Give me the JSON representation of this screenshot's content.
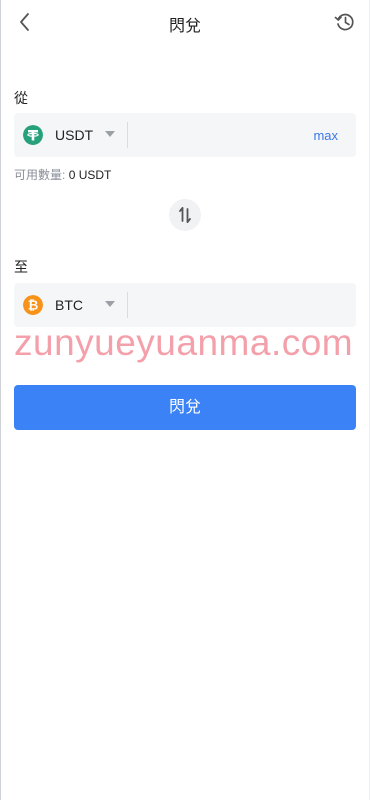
{
  "header": {
    "title": "閃兌"
  },
  "from": {
    "label": "從",
    "token": "USDT",
    "amount_placeholder": "",
    "max_label": "max",
    "available_label": "可用數量:",
    "available_value": "0 USDT",
    "icon_color": "#26a17b"
  },
  "to": {
    "label": "至",
    "token": "BTC",
    "amount_placeholder": "",
    "icon_color": "#f7931a"
  },
  "submit": {
    "label": "閃兌",
    "color": "#3b82f6"
  },
  "watermark": "zunyueyuanma.com"
}
